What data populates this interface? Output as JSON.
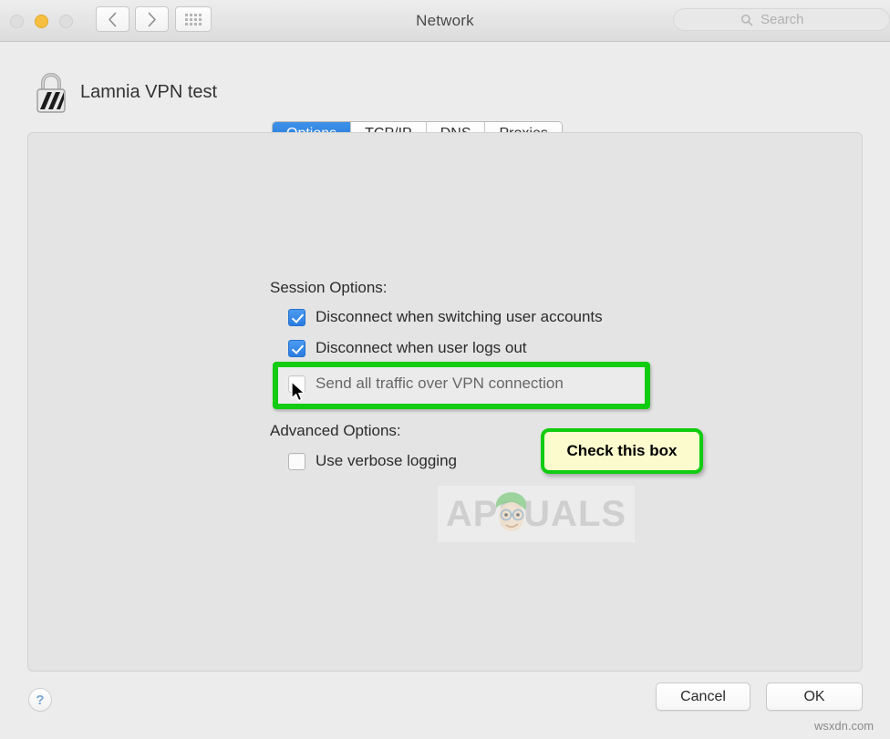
{
  "window": {
    "title": "Network",
    "traffic_lights": [
      "close",
      "minimize",
      "zoom"
    ],
    "nav_back_icon": "chevron-left-icon",
    "nav_forward_icon": "chevron-right-icon",
    "grid_icon": "show-all-grid-icon"
  },
  "search": {
    "placeholder": "Search",
    "icon": "search-icon",
    "value": ""
  },
  "sheet": {
    "icon": "vpn-lock-icon",
    "title": "Lamnia VPN test"
  },
  "tabs": [
    {
      "label": "Options",
      "selected": true
    },
    {
      "label": "TCP/IP",
      "selected": false
    },
    {
      "label": "DNS",
      "selected": false
    },
    {
      "label": "Proxies",
      "selected": false
    }
  ],
  "options": {
    "session_label": "Session Options:",
    "advanced_label": "Advanced Options:",
    "session_items": [
      {
        "label": "Disconnect when switching user accounts",
        "checked": true
      },
      {
        "label": "Disconnect when user logs out",
        "checked": true
      },
      {
        "label": "Send all traffic over VPN connection",
        "checked": false
      }
    ],
    "advanced_items": [
      {
        "label": "Use verbose logging",
        "checked": false
      }
    ]
  },
  "annotations": {
    "callout_text": "Check this box",
    "callout_fill": "#FBFBCD",
    "highlight_color": "#11CC11",
    "cursor": "mouse-pointer"
  },
  "watermark": {
    "text": "APPUALS",
    "mascot": "appuals-face-icon"
  },
  "footer": {
    "help_label": "?",
    "cancel_label": "Cancel",
    "ok_label": "OK"
  },
  "credit": "wsxdn.com"
}
